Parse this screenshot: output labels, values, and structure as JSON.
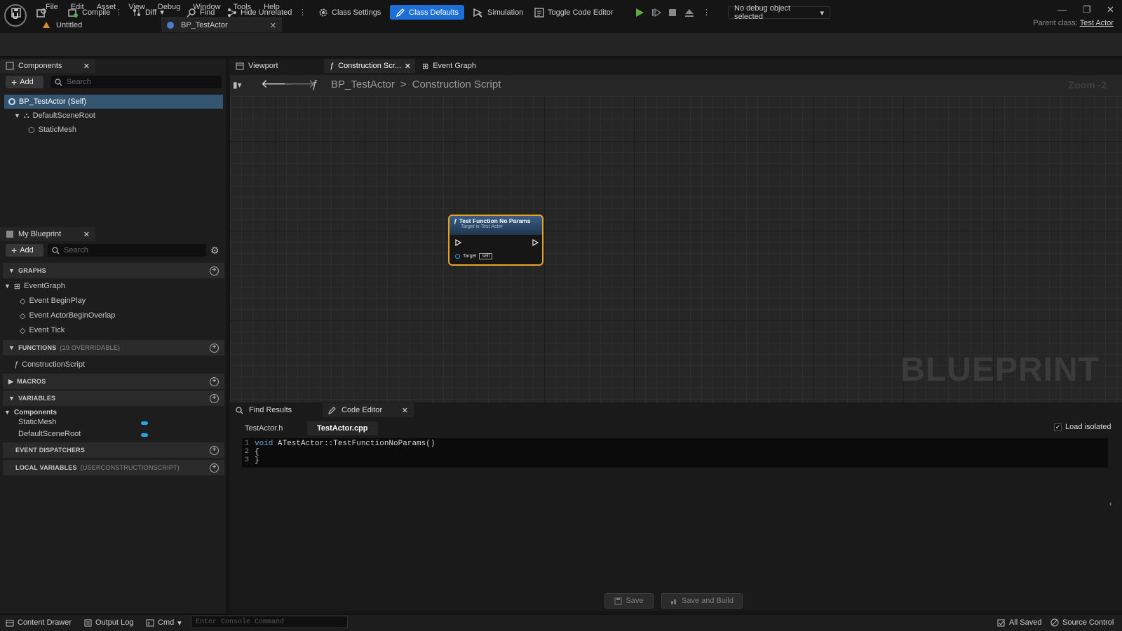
{
  "menu": [
    "File",
    "Edit",
    "Asset",
    "View",
    "Debug",
    "Window",
    "Tools",
    "Help"
  ],
  "tabs": {
    "untitled": "Untitled",
    "bp": "BP_TestActor"
  },
  "parent_class": {
    "label": "Parent class:",
    "value": "Test Actor"
  },
  "toolbar": {
    "compile": "Compile",
    "diff": "Diff",
    "find": "Find",
    "hide_unrelated": "Hide Unrelated",
    "class_settings": "Class Settings",
    "class_defaults": "Class Defaults",
    "simulation": "Simulation",
    "toggle_code_editor": "Toggle Code Editor",
    "debug_object": "No debug object selected"
  },
  "components": {
    "title": "Components",
    "add": "Add",
    "search_placeholder": "Search",
    "tree": [
      "BP_TestActor (Self)",
      "DefaultSceneRoot",
      "StaticMesh"
    ]
  },
  "my_blueprint": {
    "title": "My Blueprint",
    "add": "Add",
    "search_placeholder": "Search",
    "graphs_label": "GRAPHS",
    "event_graph": "EventGraph",
    "events": [
      "Event BeginPlay",
      "Event ActorBeginOverlap",
      "Event Tick"
    ],
    "functions_label": "FUNCTIONS",
    "functions_count": "(19 OVERRIDABLE)",
    "construction_script": "ConstructionScript",
    "macros_label": "MACROS",
    "variables_label": "VARIABLES",
    "components_group": "Components",
    "variables": [
      "StaticMesh",
      "DefaultSceneRoot"
    ],
    "event_dispatchers": "EVENT DISPATCHERS",
    "local_variables": "LOCAL VARIABLES",
    "local_scope": "(USERCONSTRUCTIONSCRIPT)"
  },
  "editor_tabs": {
    "viewport": "Viewport",
    "construction": "Construction Scr...",
    "event_graph": "Event Graph"
  },
  "breadcrumb": {
    "blueprint": "BP_TestActor",
    "separator": ">",
    "graph": "Construction Script"
  },
  "graph": {
    "zoom": "Zoom -2",
    "watermark": "BLUEPRINT"
  },
  "node": {
    "title": "Test Function No Params",
    "subtitle": "Target is Test Actor",
    "pin": "Target",
    "self": "self"
  },
  "bottom_tabs": {
    "find_results": "Find Results",
    "code_editor": "Code Editor"
  },
  "code_editor": {
    "files": [
      "TestActor.h",
      "TestActor.cpp"
    ],
    "load_isolated": "Load isolated",
    "lines": [
      {
        "n": "1",
        "kw": "void",
        "rest": " ATestActor::TestFunctionNoParams()"
      },
      {
        "n": "2",
        "kw": "",
        "rest": "{"
      },
      {
        "n": "3",
        "kw": "",
        "rest": "}"
      }
    ],
    "save": "Save",
    "save_build": "Save and Build"
  },
  "status": {
    "content_drawer": "Content Drawer",
    "output_log": "Output Log",
    "cmd": "Cmd",
    "console_placeholder": "Enter Console Command",
    "all_saved": "All Saved",
    "source_control": "Source Control"
  }
}
